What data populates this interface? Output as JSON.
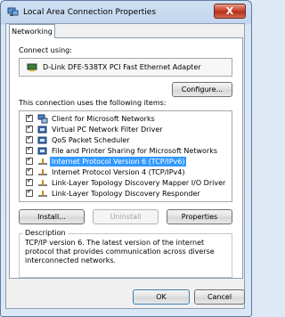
{
  "window": {
    "title": "Local Area Connection Properties",
    "close_glyph": "X"
  },
  "tabs": [
    {
      "label": "Networking"
    }
  ],
  "connect_using_label": "Connect using:",
  "adapter_name": "D-Link DFE-538TX PCI Fast Ethernet Adapter",
  "configure_button": "Configure...",
  "items_label": "This connection uses the following items:",
  "items": [
    {
      "label": "Client for Microsoft Networks",
      "checked": true,
      "icon": "client-network-icon"
    },
    {
      "label": "Virtual PC Network Filter Driver",
      "checked": true,
      "icon": "service-icon"
    },
    {
      "label": "QoS Packet Scheduler",
      "checked": true,
      "icon": "service-icon"
    },
    {
      "label": "File and Printer Sharing for Microsoft Networks",
      "checked": true,
      "icon": "service-icon"
    },
    {
      "label": "Internet Protocol Version 6 (TCP/IPv6)",
      "checked": true,
      "icon": "protocol-icon",
      "selected": true
    },
    {
      "label": "Internet Protocol Version 4 (TCP/IPv4)",
      "checked": true,
      "icon": "protocol-icon"
    },
    {
      "label": "Link-Layer Topology Discovery Mapper I/O Driver",
      "checked": true,
      "icon": "protocol-icon"
    },
    {
      "label": "Link-Layer Topology Discovery Responder",
      "checked": true,
      "icon": "protocol-icon"
    }
  ],
  "buttons": {
    "install": "Install...",
    "uninstall": "Uninstall",
    "properties": "Properties",
    "ok": "OK",
    "cancel": "Cancel"
  },
  "description": {
    "title": "Description",
    "text": "TCP/IP version 6. The latest version of the internet protocol that provides communication across diverse interconnected networks."
  },
  "colors": {
    "selection": "#3399ff",
    "close_button": "#c9422c",
    "frame": "#cfe0f3"
  }
}
